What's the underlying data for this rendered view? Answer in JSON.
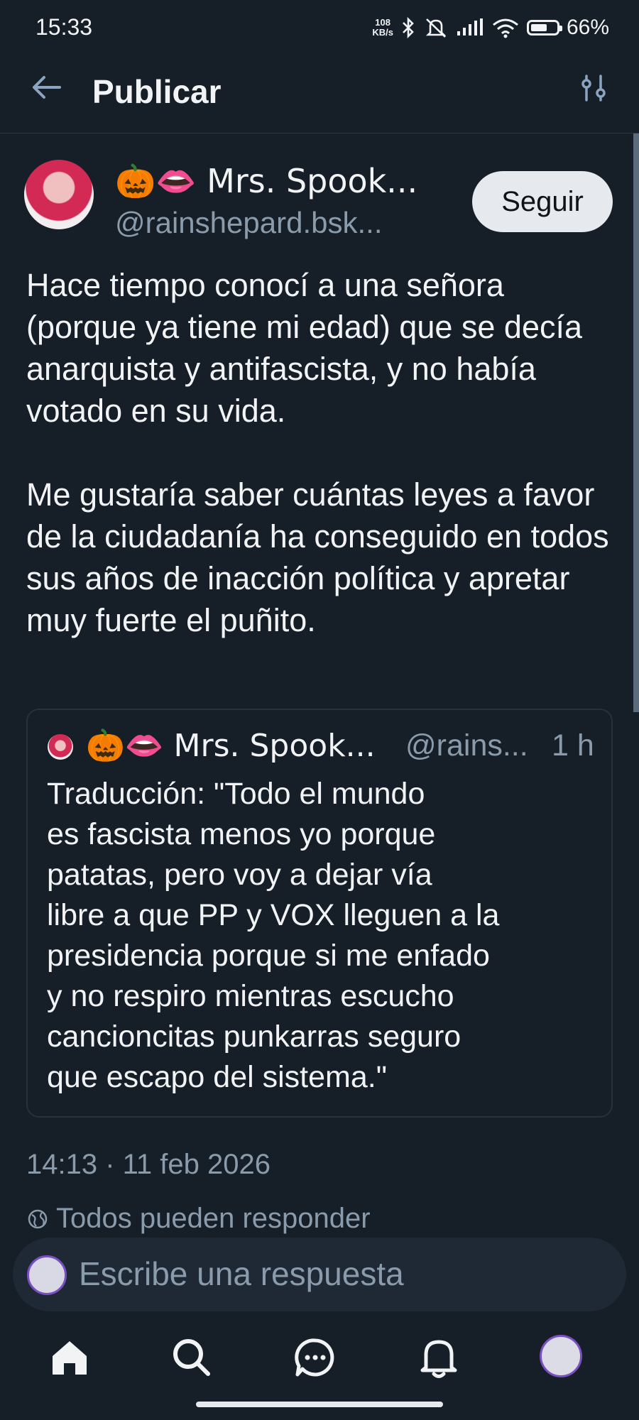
{
  "status_bar": {
    "time": "15:33",
    "speed": "108\nKB/s",
    "battery": "66%",
    "battery_level": 0.66
  },
  "header": {
    "title": "Publicar"
  },
  "post": {
    "author_name": "🎃👄 Mrs. Spook...",
    "author_handle": "@rainshepard.bsk...",
    "follow_label": "Seguir",
    "text": "Hace tiempo conocí a una señora (porque ya tiene mi edad) que se decía anarquista y antifascista, y no había votado en su vida.\n\nMe gustaría saber cuántas leyes a favor de la ciudadanía ha conseguido en todos sus años de inacción política y apretar muy fuerte el puñito.",
    "timestamp": "14:13 · 11 feb 2026",
    "reply_permission": "Todos pueden responder"
  },
  "quote": {
    "author_name": "🎃👄 Mrs. Spook...",
    "author_handle": "@rains...",
    "time": "1 h",
    "text": "Traducción: \"Todo el mundo\nes fascista menos yo porque\npatatas, pero voy a dejar vía\nlibre a que PP y VOX lleguen a la\npresidencia porque si me enfado\ny no respiro mientras escucho\ncancioncitas punkarras seguro\nque escapo del sistema.\""
  },
  "reply": {
    "placeholder": "Escribe una respuesta"
  },
  "nav": {
    "items": [
      "home-icon",
      "search-icon",
      "chat-icon",
      "bell-icon",
      "profile-avatar"
    ]
  },
  "colors": {
    "background": "#161e27",
    "text": "#f1f3f5",
    "muted": "#8a9bab",
    "follow_bg": "#e6eaee"
  }
}
